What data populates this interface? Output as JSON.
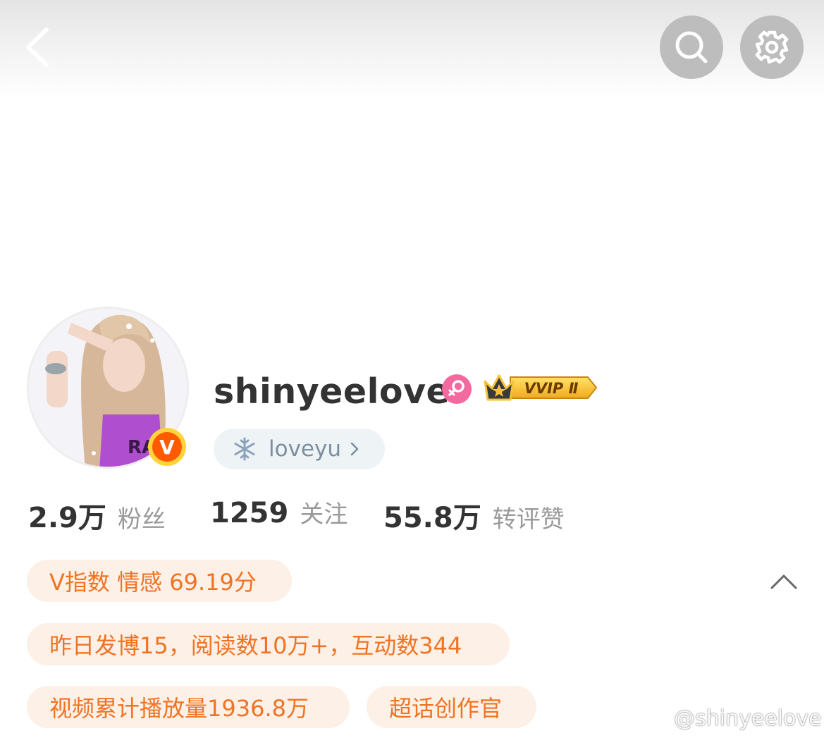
{
  "header": {
    "back_icon": "chevron-left-icon",
    "search_icon": "search-icon",
    "settings_icon": "gear-icon"
  },
  "profile": {
    "username": "shinyeelove",
    "gender_icon": "female-icon",
    "vvip_label": "VVIP Ⅱ",
    "verified_label": "V",
    "group_pill": {
      "icon": "snowflake-icon",
      "label": "loveyu"
    }
  },
  "stats": [
    {
      "value": "2.9万",
      "label": "粉丝"
    },
    {
      "value": "1259",
      "label": "关注"
    },
    {
      "value": "55.8万",
      "label": "转评赞"
    }
  ],
  "tags": {
    "vindex": "V指数 情感 69.19分",
    "yesterday": "昨日发博15，阅读数10万+，互动数344",
    "video": "视频累计播放量1936.8万",
    "officer": "超话创作官"
  },
  "watermark": "@shinyeelove",
  "colors": {
    "tag_text": "#f07322",
    "tag_bg": "#fdf0e6",
    "stat_number": "#333333",
    "stat_label": "#9a9a9a",
    "vvip_gold": "#f5c23a",
    "verified_orange": "#ff6a00"
  }
}
